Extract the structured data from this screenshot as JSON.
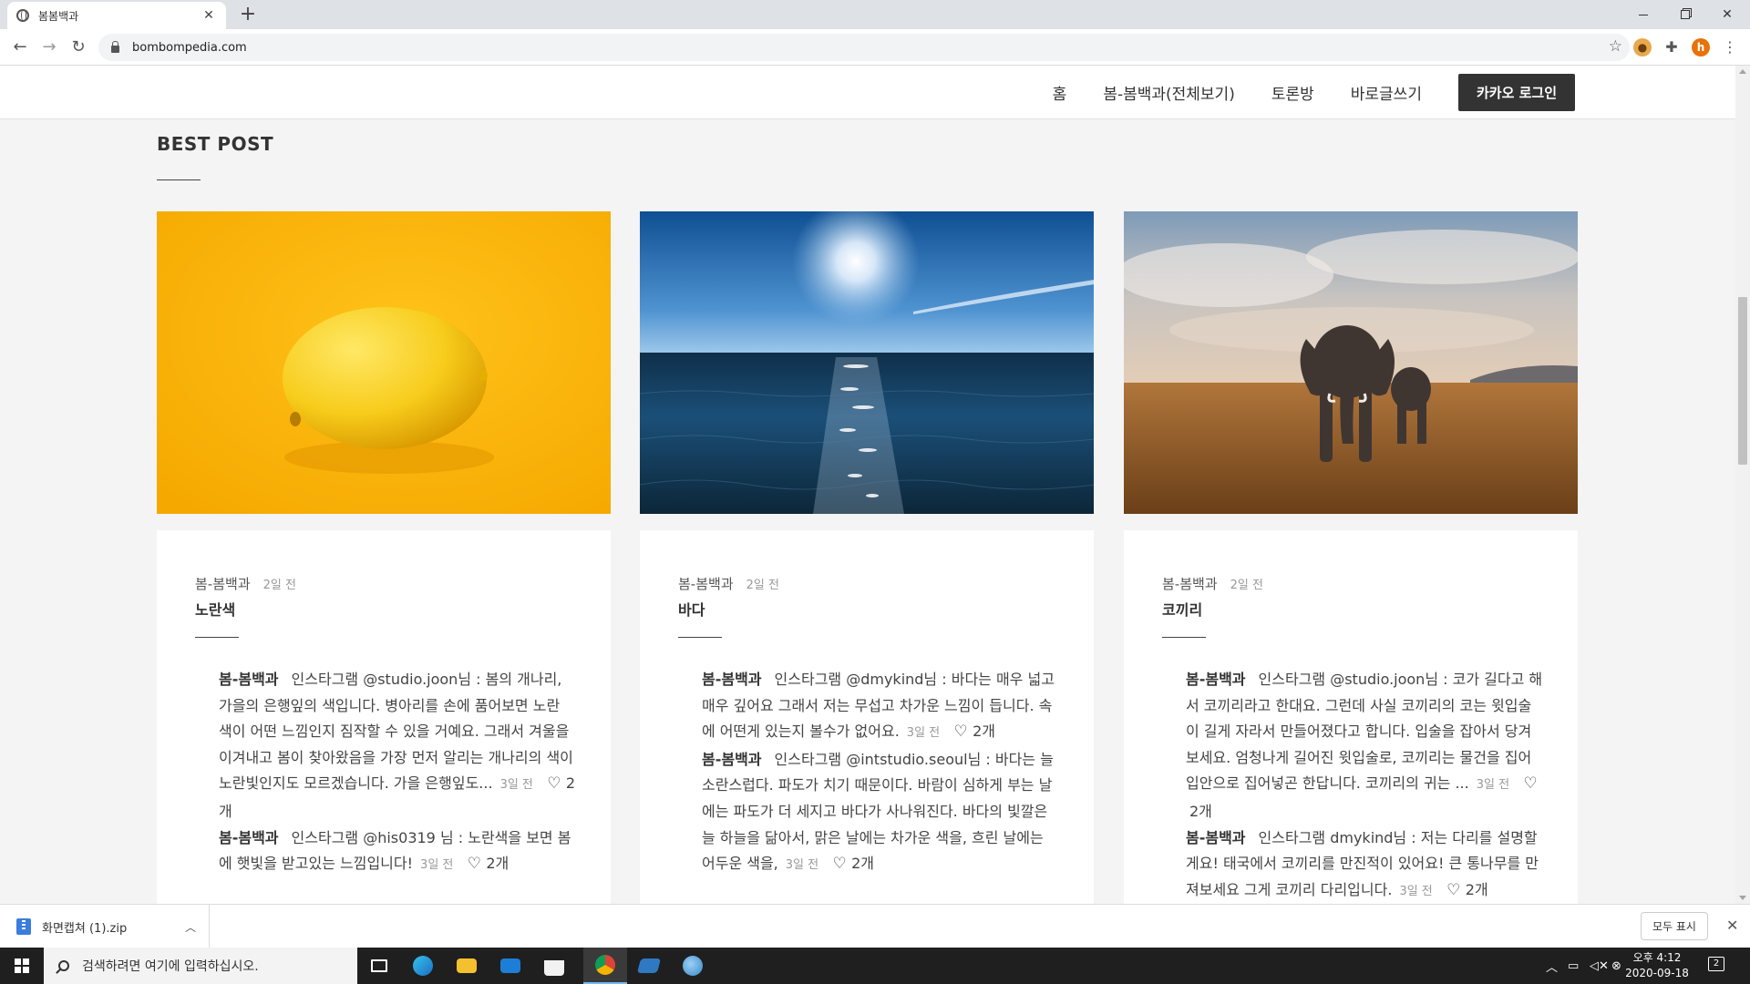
{
  "browser": {
    "tab_title": "봄봄백과",
    "url": "bombompedia.com"
  },
  "site": {
    "nav": [
      "홈",
      "봄-봄백과(전체보기)",
      "토론방",
      "바로글쓰기"
    ],
    "login_label": "카카오 로그인"
  },
  "section_title": "BEST POST",
  "posts": [
    {
      "category": "봄-봄백과",
      "time": "2일 전",
      "title": "노란색",
      "image": "lemon-photo",
      "comments": [
        {
          "author": "봄-봄백과",
          "text": "인스타그램 @studio.joon님 : 봄의 개나리, 가을의 은행잎의 색입니다. 병아리를 손에 품어보면 노란 색이 어떤 느낌인지 짐작할 수 있을 거예요. 그래서 겨울을 이겨내고 봄이 찾아왔음을 가장 먼저 알리는 개나리의 색이 노란빛인지도 모르겠습니다. 가을 은행잎도...",
          "time": "3일 전",
          "likes": "2개"
        },
        {
          "author": "봄-봄백과",
          "text": "인스타그램 @his0319 님 : 노란색을 보면 봄에 햇빛을 받고있는 느낌입니다!",
          "time": "3일 전",
          "likes": "2개"
        }
      ]
    },
    {
      "category": "봄-봄백과",
      "time": "2일 전",
      "title": "바다",
      "image": "ocean-photo",
      "comments": [
        {
          "author": "봄-봄백과",
          "text": "인스타그램 @dmykind님 : 바다는 매우 넓고 매우 깊어요 그래서 저는 무섭고 차가운 느낌이 듭니다. 속에 어떤게 있는지 볼수가 없어요.",
          "time": "3일 전",
          "likes": "2개"
        },
        {
          "author": "봄-봄백과",
          "text": "인스타그램 @intstudio.seoul님 : 바다는 늘 소란스럽다. 파도가 치기 때문이다. 바람이 심하게 부는 날에는 파도가 더 세지고 바다가 사나워진다. 바다의 빛깔은 늘 하늘을 닮아서, 맑은 날에는 차가운 색을, 흐린 날에는 어두운 색을,",
          "time": "3일 전",
          "likes": "2개"
        }
      ]
    },
    {
      "category": "봄-봄백과",
      "time": "2일 전",
      "title": "코끼리",
      "image": "elephant-photo",
      "comments": [
        {
          "author": "봄-봄백과",
          "text": "인스타그램 @studio.joon님 : 코가 길다고 해서 코끼리라고 한대요. 그런데 사실 코끼리의 코는 윗입술이 길게 자라서 만들어졌다고 합니다. 입술을 잡아서 당겨보세요. 엄청나게 길어진 윗입술로, 코끼리는 물건을 집어 입안으로 집어넣곤 한답니다. 코끼리의 귀는 ...",
          "time": "3일 전",
          "likes": "2개"
        },
        {
          "author": "봄-봄백과",
          "text": "인스타그램 dmykind님 : 저는 다리를 설명할게요! 태국에서 코끼리를 만진적이 있어요! 큰 통나무를 만져보세요 그게 코끼리 다리입니다.",
          "time": "3일 전",
          "likes": "2개"
        }
      ]
    }
  ],
  "download": {
    "file_name": "화면캡쳐 (1).zip",
    "show_all": "모두 표시"
  },
  "taskbar": {
    "search_placeholder": "검색하려면 여기에 입력하십시오.",
    "time": "오후 4:12",
    "date": "2020-09-18",
    "notifications": "2"
  },
  "colors": {
    "lemon_bg": "#f7b500",
    "ocean": "#0e3a5c",
    "login_btn": "#333333"
  }
}
